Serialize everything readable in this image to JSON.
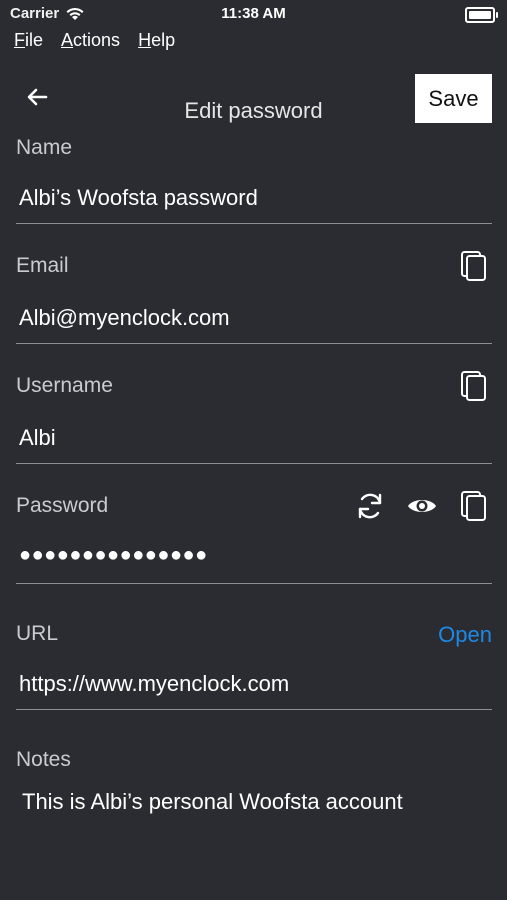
{
  "status_bar": {
    "carrier": "Carrier",
    "time": "11:38 AM"
  },
  "menu": {
    "items": [
      {
        "label": "File",
        "underline": "F"
      },
      {
        "label": "Actions",
        "underline": "A"
      },
      {
        "label": "Help",
        "underline": "H"
      }
    ]
  },
  "header": {
    "title": "Edit password",
    "save_label": "Save",
    "back_icon": "arrow-left-icon"
  },
  "form": {
    "name": {
      "label": "Name",
      "value": "Albi’s Woofsta password"
    },
    "email": {
      "label": "Email",
      "value": "Albi@myenclock.com",
      "icon": "copy-icon"
    },
    "username": {
      "label": "Username",
      "value": "Albi",
      "icon": "copy-icon"
    },
    "password": {
      "label": "Password",
      "value": "●●●●●●●●●●●●●●●",
      "icons": [
        "refresh-icon",
        "eye-icon",
        "copy-icon"
      ]
    },
    "url": {
      "label": "URL",
      "value": "https://www.myenclock.com",
      "action": "Open"
    },
    "notes": {
      "label": "Notes",
      "value": "This is Albi’s personal Woofsta account"
    }
  },
  "colors": {
    "background": "#2a2c31",
    "accent": "#1e88e5",
    "divider": "#8c8f96"
  }
}
